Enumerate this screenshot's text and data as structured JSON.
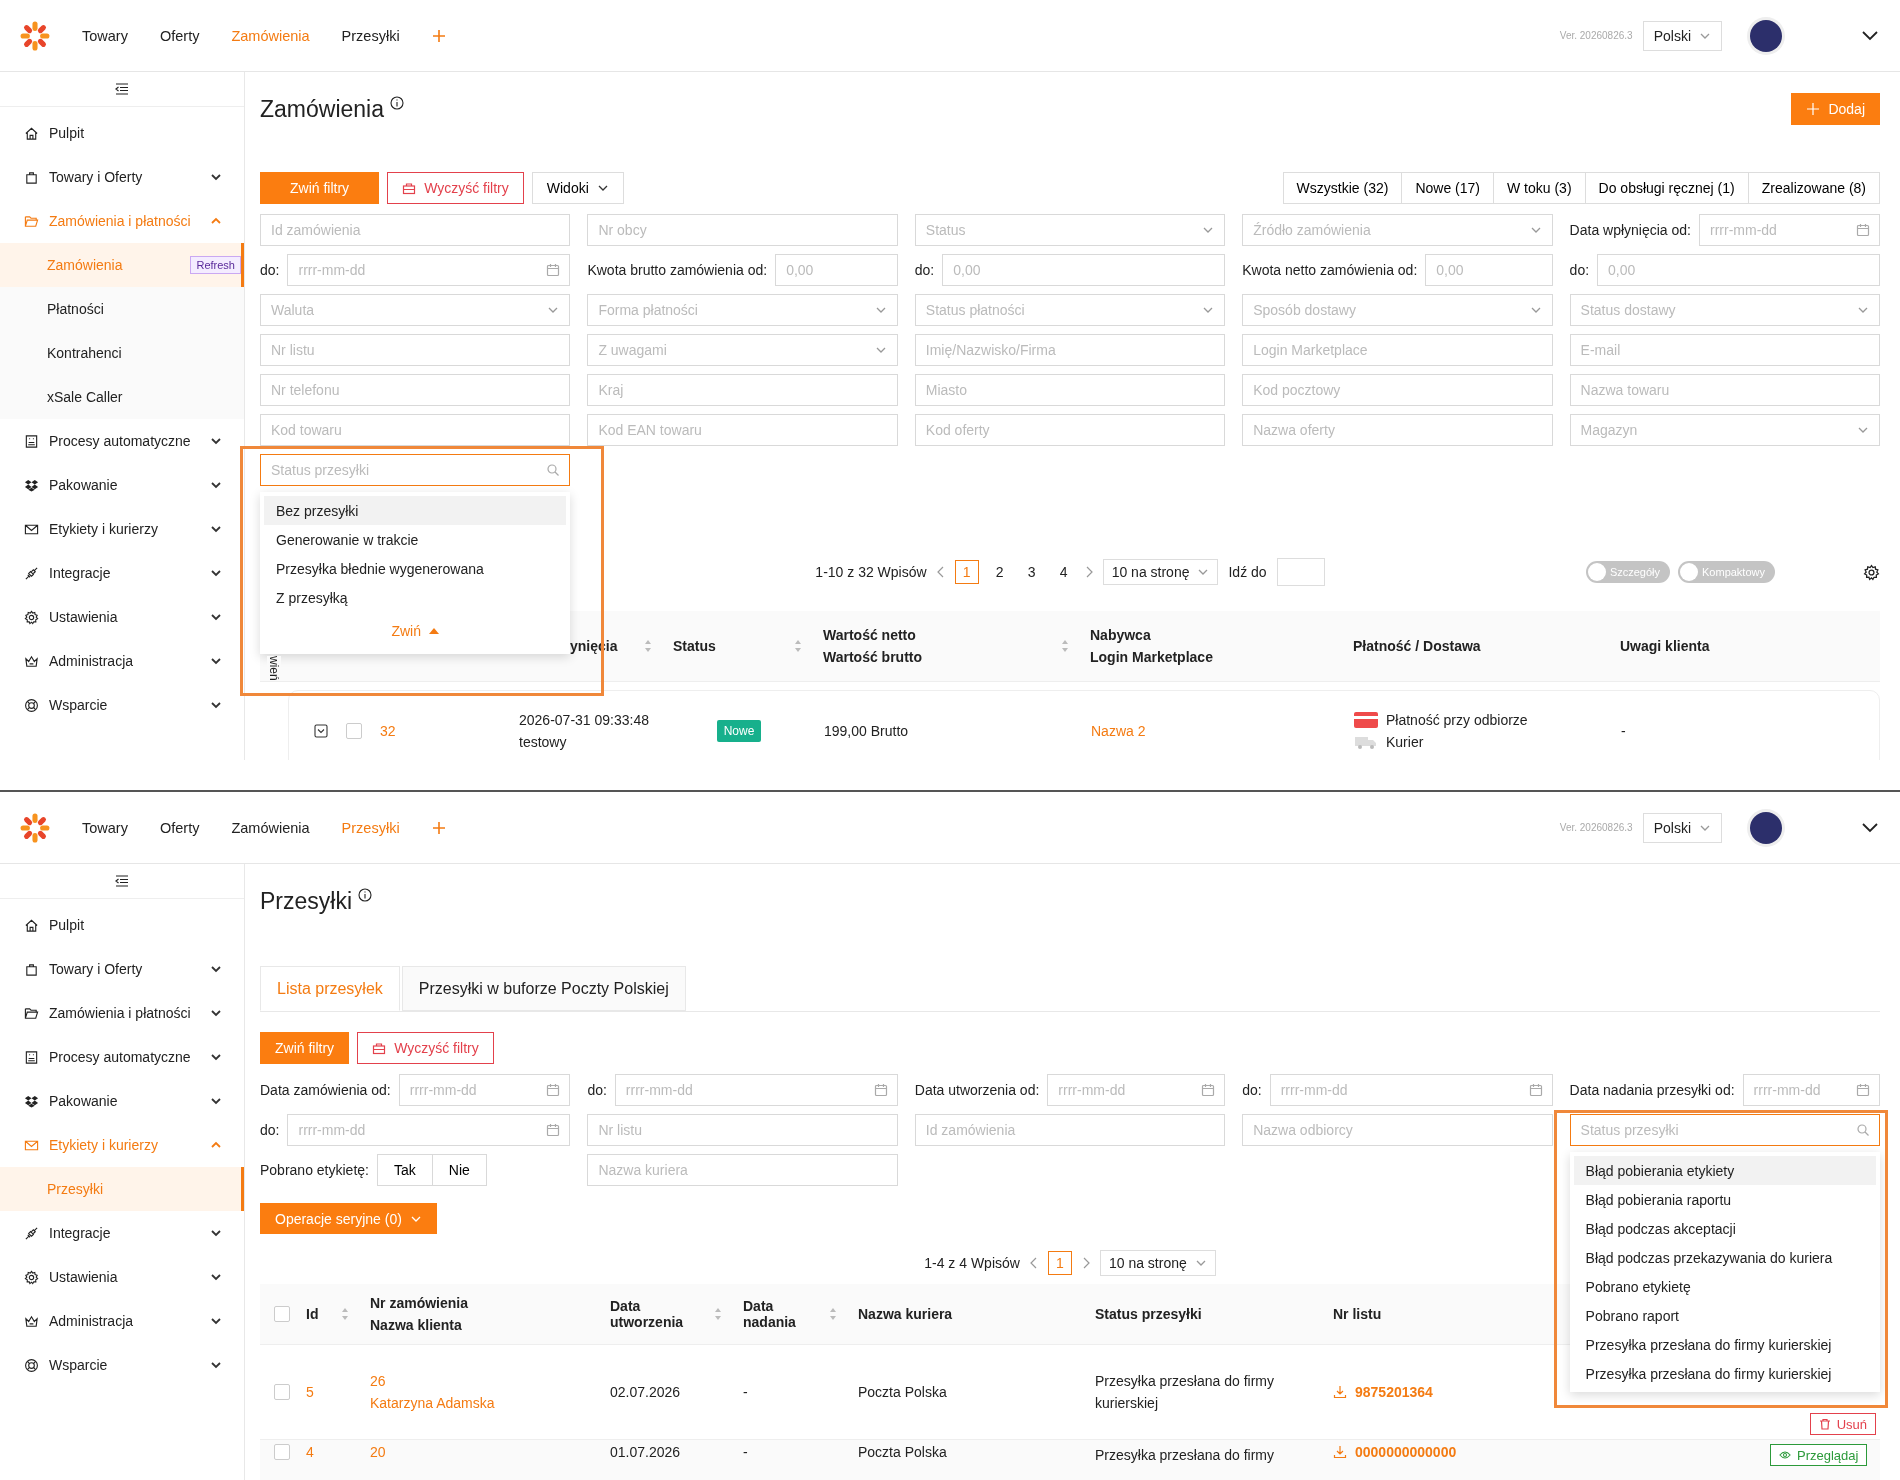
{
  "orders_view": {
    "top_nav": [
      {
        "label": "Towary",
        "selected": false
      },
      {
        "label": "Oferty",
        "selected": false
      },
      {
        "label": "Zamówienia",
        "selected": true
      },
      {
        "label": "Przesyłki",
        "selected": false
      }
    ],
    "version": "Ver. 20260826.3",
    "language": "Polski",
    "sidebar": [
      {
        "label": "Pulpit"
      },
      {
        "label": "Towary i Oferty",
        "expanded": false
      },
      {
        "label": "Zamówienia i płatności",
        "expanded": true,
        "children": [
          {
            "label": "Zamówienia",
            "badge": "Refresh",
            "selected": true
          },
          {
            "label": "Płatności",
            "selected": false
          },
          {
            "label": "Kontrahenci",
            "selected": false
          },
          {
            "label": "xSale Caller",
            "selected": false
          }
        ]
      },
      {
        "label": "Procesy automatyczne",
        "expanded": false
      },
      {
        "label": "Pakowanie",
        "expanded": false
      },
      {
        "label": "Etykiety i kurierzy",
        "expanded": false
      },
      {
        "label": "Integracje",
        "expanded": false
      },
      {
        "label": "Ustawienia",
        "expanded": false
      },
      {
        "label": "Administracja",
        "expanded": false
      },
      {
        "label": "Wsparcie",
        "expanded": false
      }
    ],
    "title": "Zamówienia",
    "add_button": "Dodaj",
    "toolbar": {
      "collapse_filters": "Zwiń filtry",
      "clear_filters": "Wyczyść filtry",
      "views": "Widoki"
    },
    "status_tabs": [
      "Wszystkie (32)",
      "Nowe (17)",
      "W toku (3)",
      "Do obsługi ręcznej (1)",
      "Zrealizowane (8)"
    ],
    "filters": [
      {
        "kind": "text",
        "placeholder": "Id zamówienia"
      },
      {
        "kind": "text",
        "placeholder": "Nr obcy"
      },
      {
        "kind": "select",
        "placeholder": "Status"
      },
      {
        "kind": "select",
        "placeholder": "Źródło zamówienia"
      },
      {
        "kind": "date",
        "label": "Data wpłynięcia od:",
        "placeholder": "rrrr-mm-dd"
      },
      {
        "kind": "date",
        "label": "do:",
        "placeholder": "rrrr-mm-dd"
      },
      {
        "kind": "amount",
        "label": "Kwota brutto zamówienia od:",
        "placeholder": "0,00"
      },
      {
        "kind": "amount",
        "label": "do:",
        "placeholder": "0,00"
      },
      {
        "kind": "amount",
        "label": "Kwota netto zamówienia od:",
        "placeholder": "0,00"
      },
      {
        "kind": "amount",
        "label": "do:",
        "placeholder": "0,00"
      },
      {
        "kind": "select",
        "placeholder": "Waluta"
      },
      {
        "kind": "select",
        "placeholder": "Forma płatności"
      },
      {
        "kind": "select",
        "placeholder": "Status płatności"
      },
      {
        "kind": "select",
        "placeholder": "Sposób dostawy"
      },
      {
        "kind": "select",
        "placeholder": "Status dostawy"
      },
      {
        "kind": "text",
        "placeholder": "Nr listu"
      },
      {
        "kind": "select",
        "placeholder": "Z uwagami"
      },
      {
        "kind": "text",
        "placeholder": "Imię/Nazwisko/Firma"
      },
      {
        "kind": "text",
        "placeholder": "Login Marketplace"
      },
      {
        "kind": "text",
        "placeholder": "E-mail"
      },
      {
        "kind": "text",
        "placeholder": "Nr telefonu"
      },
      {
        "kind": "text",
        "placeholder": "Kraj"
      },
      {
        "kind": "text",
        "placeholder": "Miasto"
      },
      {
        "kind": "text",
        "placeholder": "Kod pocztowy"
      },
      {
        "kind": "text",
        "placeholder": "Nazwa towaru"
      },
      {
        "kind": "text",
        "placeholder": "Kod towaru"
      },
      {
        "kind": "text",
        "placeholder": "Kod EAN towaru"
      },
      {
        "kind": "text",
        "placeholder": "Kod oferty"
      },
      {
        "kind": "text",
        "placeholder": "Nazwa oferty"
      },
      {
        "kind": "select",
        "placeholder": "Magazyn"
      },
      {
        "kind": "search",
        "placeholder": "Status przesyłki",
        "focused": true,
        "annotated": true,
        "collapse_label": "Zwiń",
        "options": [
          {
            "label": "Bez przesyłki",
            "selected": true
          },
          {
            "label": "Generowanie w trakcie",
            "selected": false
          },
          {
            "label": "Przesyłka błednie wygenerowana",
            "selected": false
          },
          {
            "label": "Z przesyłką",
            "selected": false
          }
        ]
      }
    ],
    "pagination": {
      "summary": "1-10 z 32 Wpisów",
      "pages": [
        {
          "label": "1",
          "selected": true
        },
        {
          "label": "2",
          "selected": false
        },
        {
          "label": "3",
          "selected": false
        },
        {
          "label": "4",
          "selected": false
        }
      ],
      "page_size": "10 na stronę",
      "goto_label": "Idź do"
    },
    "view_toggles": [
      {
        "label": "Szczegóły",
        "on": false
      },
      {
        "label": "Kompaktowy",
        "on": false
      }
    ],
    "table": {
      "side_label": "wień",
      "columns": [
        {
          "lines": [
            "ynięcia"
          ],
          "sortable": true
        },
        {
          "lines": [
            "Status"
          ],
          "sortable": true
        },
        {
          "lines": [
            "Wartość netto",
            "Wartość brutto"
          ],
          "sortable": true
        },
        {
          "lines": [
            "Nabywca",
            "Login Marketplace"
          ],
          "sortable": false
        },
        {
          "lines": [
            "Płatność / Dostawa"
          ],
          "sortable": false
        },
        {
          "lines": [
            "Uwagi klienta"
          ],
          "sortable": false
        }
      ],
      "rows": [
        {
          "expanded": false,
          "checked": false,
          "id": "32",
          "date": "2026-07-31 09:33:48",
          "source": "testowy",
          "status": "Nowe",
          "value": "199,00 Brutto",
          "buyer": "Nazwa 2",
          "payment": "Płatność przy odbiorze",
          "delivery": "Kurier",
          "notes": "-"
        }
      ]
    }
  },
  "shipments_view": {
    "top_nav": [
      {
        "label": "Towary",
        "selected": false
      },
      {
        "label": "Oferty",
        "selected": false
      },
      {
        "label": "Zamówienia",
        "selected": false
      },
      {
        "label": "Przesyłki",
        "selected": true
      }
    ],
    "version": "Ver. 20260826.3",
    "language": "Polski",
    "sidebar": [
      {
        "label": "Pulpit"
      },
      {
        "label": "Towary i Oferty",
        "expanded": false
      },
      {
        "label": "Zamówienia i płatności",
        "expanded": false
      },
      {
        "label": "Procesy automatyczne",
        "expanded": false
      },
      {
        "label": "Pakowanie",
        "expanded": false
      },
      {
        "label": "Etykiety i kurierzy",
        "expanded": true,
        "children": [
          {
            "label": "Przesyłki",
            "selected": true
          }
        ]
      },
      {
        "label": "Integracje",
        "expanded": false
      },
      {
        "label": "Ustawienia",
        "expanded": false
      },
      {
        "label": "Administracja",
        "expanded": false
      },
      {
        "label": "Wsparcie",
        "expanded": false
      }
    ],
    "title": "Przesyłki",
    "tabs": [
      {
        "label": "Lista przesyłek",
        "selected": true
      },
      {
        "label": "Przesyłki w buforze Poczty Polskiej",
        "selected": false
      }
    ],
    "toolbar": {
      "collapse_filters": "Zwiń filtry",
      "clear_filters": "Wyczyść filtry"
    },
    "filters": [
      {
        "kind": "date",
        "label": "Data zamówienia od:",
        "placeholder": "rrrr-mm-dd"
      },
      {
        "kind": "date",
        "label": "do:",
        "placeholder": "rrrr-mm-dd"
      },
      {
        "kind": "date",
        "label": "Data utworzenia od:",
        "placeholder": "rrrr-mm-dd"
      },
      {
        "kind": "date",
        "label": "do:",
        "placeholder": "rrrr-mm-dd"
      },
      {
        "kind": "date",
        "label": "Data nadania przesyłki od:",
        "placeholder": "rrrr-mm-dd"
      },
      {
        "kind": "date",
        "label": "do:",
        "placeholder": "rrrr-mm-dd"
      },
      {
        "kind": "text",
        "placeholder": "Nr listu"
      },
      {
        "kind": "text",
        "placeholder": "Id zamówienia"
      },
      {
        "kind": "text",
        "placeholder": "Nazwa odbiorcy"
      },
      {
        "kind": "search",
        "placeholder": "Status przesyłki",
        "focused": true,
        "annotated": true,
        "options": [
          {
            "label": "Błąd pobierania etykiety",
            "selected": true
          },
          {
            "label": "Błąd pobierania raportu",
            "selected": false
          },
          {
            "label": "Błąd podczas akceptacji",
            "selected": false
          },
          {
            "label": "Błąd podczas przekazywania do kuriera",
            "selected": false
          },
          {
            "label": "Pobrano etykietę",
            "selected": false
          },
          {
            "label": "Pobrano raport",
            "selected": false
          },
          {
            "label": "Przesyłka przesłana do firmy kurierskiej",
            "selected": false
          },
          {
            "label": "Przesyłka przesłana do firmy kurierskiej",
            "selected": false
          }
        ]
      },
      {
        "kind": "choice",
        "label": "Pobrano etykietę:",
        "choices": [
          "Tak",
          "Nie"
        ]
      },
      {
        "kind": "text",
        "placeholder": "Nazwa kuriera"
      }
    ],
    "bulk_button": "Operacje seryjne (0)",
    "pagination": {
      "summary": "1-4 z 4 Wpisów",
      "pages": [
        {
          "label": "1",
          "selected": true
        }
      ],
      "page_size": "10 na stronę"
    },
    "table": {
      "all_checked": false,
      "columns": [
        {
          "lines": [
            "Id"
          ],
          "sortable": true
        },
        {
          "lines": [
            "Nr zamówienia",
            "Nazwa klienta"
          ],
          "sortable": false
        },
        {
          "lines": [
            "Data utworzenia"
          ],
          "sortable": true
        },
        {
          "lines": [
            "Data nadania"
          ],
          "sortable": true
        },
        {
          "lines": [
            "Nazwa kuriera"
          ],
          "sortable": false
        },
        {
          "lines": [
            "Status przesyłki"
          ],
          "sortable": false
        },
        {
          "lines": [
            "Nr listu"
          ],
          "sortable": false
        }
      ],
      "rows": [
        {
          "checked": false,
          "id": "5",
          "order_no": "26",
          "client": "Katarzyna Adamska",
          "created": "02.07.2026",
          "sent": "-",
          "courier": "Poczta Polska",
          "status": "Przesyłka przesłana do firmy kurierskiej",
          "tracking": "9875201364",
          "actions": [
            {
              "kind": "delete",
              "label": "Usuń"
            }
          ]
        },
        {
          "checked": false,
          "id": "4",
          "order_no": "20",
          "created": "01.07.2026",
          "sent": "-",
          "courier": "Poczta Polska",
          "status": "Przesyłka przesłana do firmy",
          "tracking": "0000000000000",
          "actions": [
            {
              "kind": "view",
              "label": "Przeglądaj"
            }
          ]
        }
      ]
    }
  }
}
